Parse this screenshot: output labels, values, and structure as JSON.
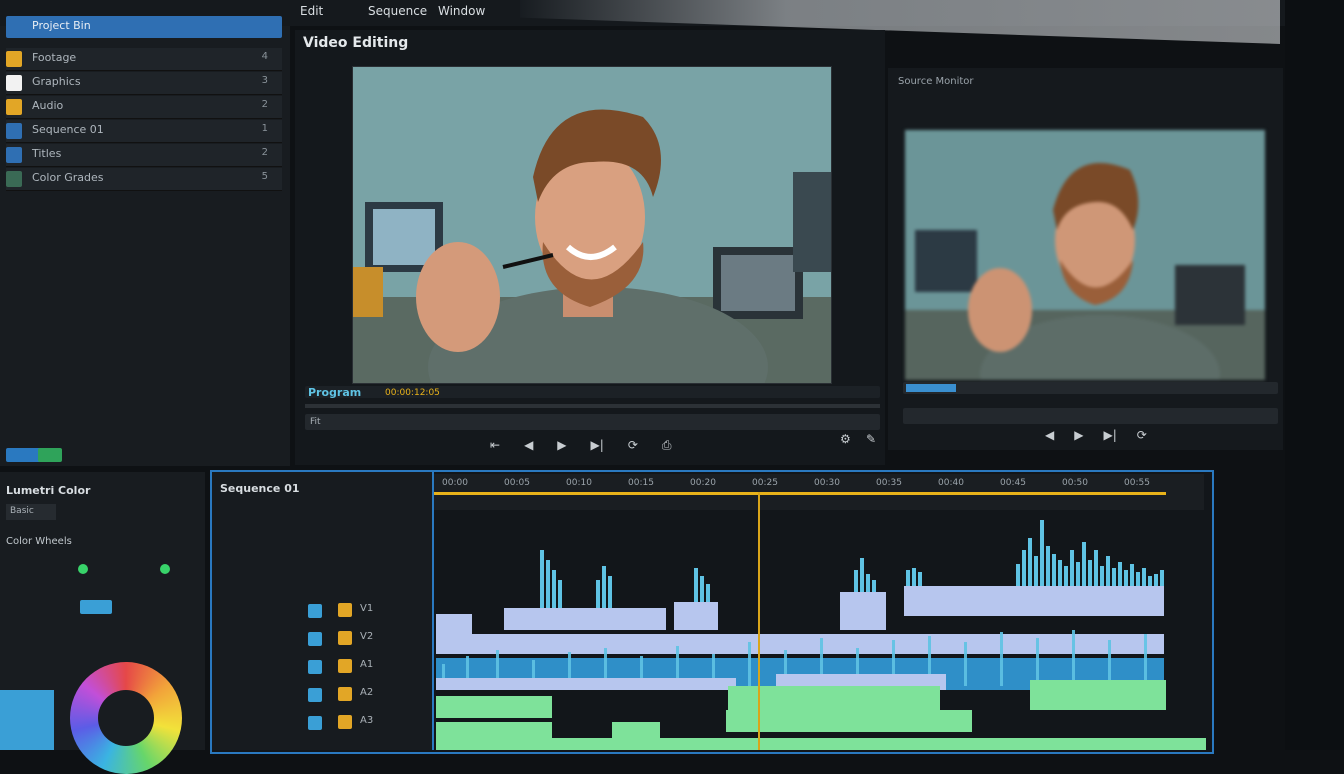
{
  "menu": [
    "Edit",
    "Sequence",
    "Window"
  ],
  "monitor_title": "Video Editing",
  "source_title": "Source Monitor",
  "project": {
    "header": "Project Bin",
    "items": [
      {
        "label": "Footage",
        "count": "4",
        "color": "#e2a626"
      },
      {
        "label": "Graphics",
        "count": "3",
        "color": "#f2f2f2"
      },
      {
        "label": "Audio",
        "count": "2",
        "color": "#e2a626"
      },
      {
        "label": "Sequence 01",
        "count": "1",
        "color": "#2f6fb3"
      },
      {
        "label": "Titles",
        "count": "2",
        "color": "#2f6fb3"
      },
      {
        "label": "Color Grades",
        "count": "5",
        "color": "#3a6a55"
      }
    ]
  },
  "program": {
    "timecode": "00:00:12:05",
    "label": "Program",
    "in_label": "Fit"
  },
  "timeline": {
    "title": "Sequence 01",
    "tracks": [
      "V1",
      "V2",
      "A1",
      "A2",
      "A3"
    ],
    "ruler_ticks": [
      "00:00",
      "00:05",
      "00:10",
      "00:15",
      "00:20",
      "00:25",
      "00:30",
      "00:35",
      "00:40",
      "00:45",
      "00:50",
      "00:55"
    ]
  },
  "effects": {
    "title": "Lumetri Color",
    "subtitle": "Basic",
    "section": "Color Wheels"
  },
  "colors": {
    "accent": "#2a79c0",
    "playhead": "#e8b21a",
    "clip_blue": "#5fc3e4",
    "clip_lavender": "#b7c6ee",
    "clip_green": "#7ee29a"
  }
}
